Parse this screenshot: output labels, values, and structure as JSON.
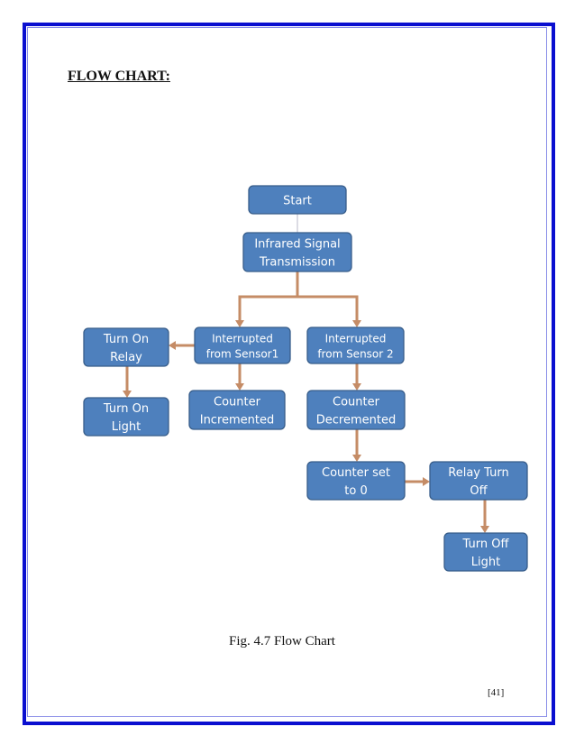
{
  "document": {
    "heading": "FLOW CHART:",
    "caption": "Fig. 4.7 Flow Chart",
    "page_number": "[41]"
  },
  "colors": {
    "border": "#0a0fd0",
    "node_fill": "#4e80bd",
    "node_stroke": "#385d8a",
    "connector": "#c58c66"
  },
  "flowchart": {
    "nodes": [
      {
        "id": "start",
        "lines": [
          "Start"
        ]
      },
      {
        "id": "infrared",
        "lines": [
          "Infrared Signal",
          "Transmission"
        ]
      },
      {
        "id": "sensor1",
        "lines": [
          "Interrupted",
          "from Sensor1"
        ]
      },
      {
        "id": "sensor2",
        "lines": [
          "Interrupted",
          "from Sensor 2"
        ]
      },
      {
        "id": "relay-on",
        "lines": [
          "Turn On",
          "Relay"
        ]
      },
      {
        "id": "light-on",
        "lines": [
          "Turn On",
          "Light"
        ]
      },
      {
        "id": "incremented",
        "lines": [
          "Counter",
          "Incremented"
        ]
      },
      {
        "id": "decremented",
        "lines": [
          "Counter",
          "Decremented"
        ]
      },
      {
        "id": "set-zero",
        "lines": [
          "Counter set",
          "to 0"
        ]
      },
      {
        "id": "relay-off",
        "lines": [
          "Relay Turn",
          "Off"
        ]
      },
      {
        "id": "light-off",
        "lines": [
          "Turn Off",
          "Light"
        ]
      }
    ],
    "edges": [
      {
        "from": "start",
        "to": "infrared"
      },
      {
        "from": "infrared",
        "to": "sensor1"
      },
      {
        "from": "infrared",
        "to": "sensor2"
      },
      {
        "from": "sensor1",
        "to": "relay-on"
      },
      {
        "from": "relay-on",
        "to": "light-on"
      },
      {
        "from": "sensor1",
        "to": "incremented"
      },
      {
        "from": "sensor2",
        "to": "decremented"
      },
      {
        "from": "decremented",
        "to": "set-zero"
      },
      {
        "from": "set-zero",
        "to": "relay-off"
      },
      {
        "from": "relay-off",
        "to": "light-off"
      }
    ]
  }
}
